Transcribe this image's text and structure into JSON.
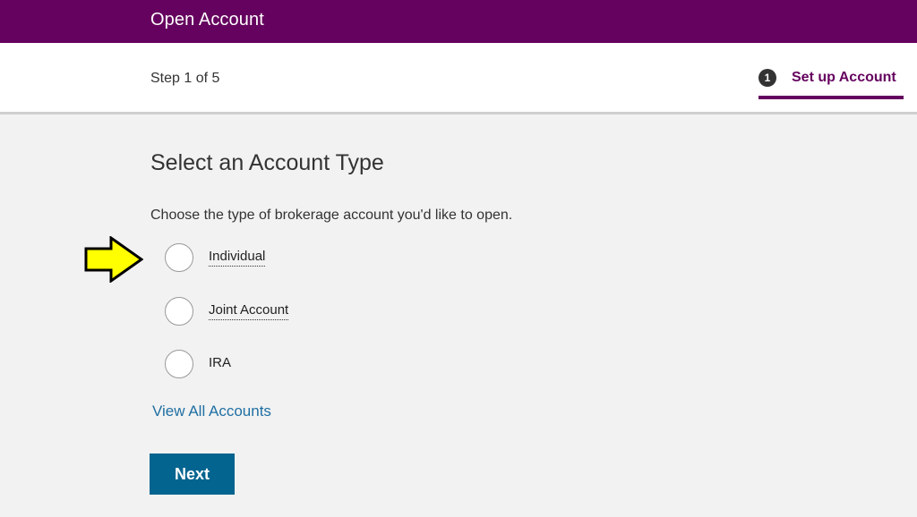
{
  "header": {
    "title": "Open Account"
  },
  "stepbar": {
    "step_count": "Step 1 of 5",
    "current_step_number": "1",
    "current_step_label": "Set up Account"
  },
  "main": {
    "heading": "Select an Account Type",
    "intro": "Choose the type of brokerage account you'd like to open.",
    "options": [
      {
        "label": "Individual",
        "selected": false
      },
      {
        "label": "Joint Account",
        "selected": false
      },
      {
        "label": "IRA",
        "selected": false
      }
    ],
    "view_all_link": "View All Accounts",
    "next_button": "Next"
  },
  "annotation": {
    "arrow_icon": "yellow-right-arrow-icon",
    "arrow_color": "#ffff00"
  },
  "colors": {
    "brand": "#65015e",
    "button": "#03648f",
    "link": "#1f6fa3"
  }
}
